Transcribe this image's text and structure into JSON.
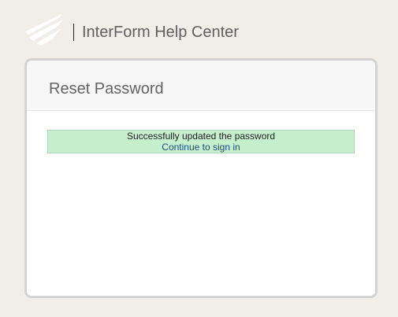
{
  "header": {
    "brand_title": "InterForm Help Center",
    "logo_icon": "interform-logo-icon"
  },
  "card": {
    "title": "Reset Password",
    "alert": {
      "message": "Successfully updated the password",
      "link_label": "Continue to sign in"
    }
  },
  "colors": {
    "page_background": "#f1eee9",
    "alert_background": "#c6efce",
    "link": "#1c4e7d"
  }
}
